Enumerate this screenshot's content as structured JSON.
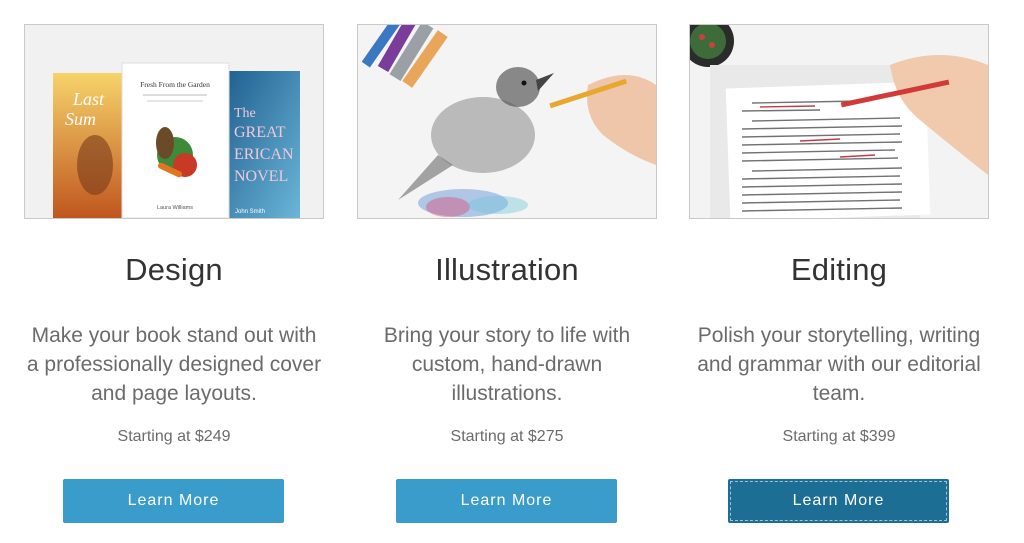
{
  "cards": [
    {
      "title": "Design",
      "description": "Make your book stand out with a professionally designed cover and page layouts.",
      "price": "Starting at $249",
      "button": "Learn More",
      "image": {
        "book_title": "Fresh From the Garden",
        "book_author": "Laura Williams",
        "back_book_words": [
          "The",
          "GREAT",
          "ERICAN",
          "NOVEL"
        ],
        "back_book_author": "John Smith",
        "left_book_words": [
          "Last",
          "Sum"
        ]
      }
    },
    {
      "title": "Illustration",
      "description": "Bring your story to life with custom, hand-drawn illustrations.",
      "price": "Starting at $275",
      "button": "Learn More"
    },
    {
      "title": "Editing",
      "description": "Polish your storytelling, writing and grammar with our editorial team.",
      "price": "Starting at $399",
      "button": "Learn More"
    }
  ],
  "colors": {
    "button": "#3a9ccb",
    "button_active": "#1d6e94",
    "title": "#333333",
    "body_text": "#6b6b6b"
  },
  "icons": [
    "books-photo",
    "bird-sketch-photo",
    "manuscript-edit-photo"
  ]
}
